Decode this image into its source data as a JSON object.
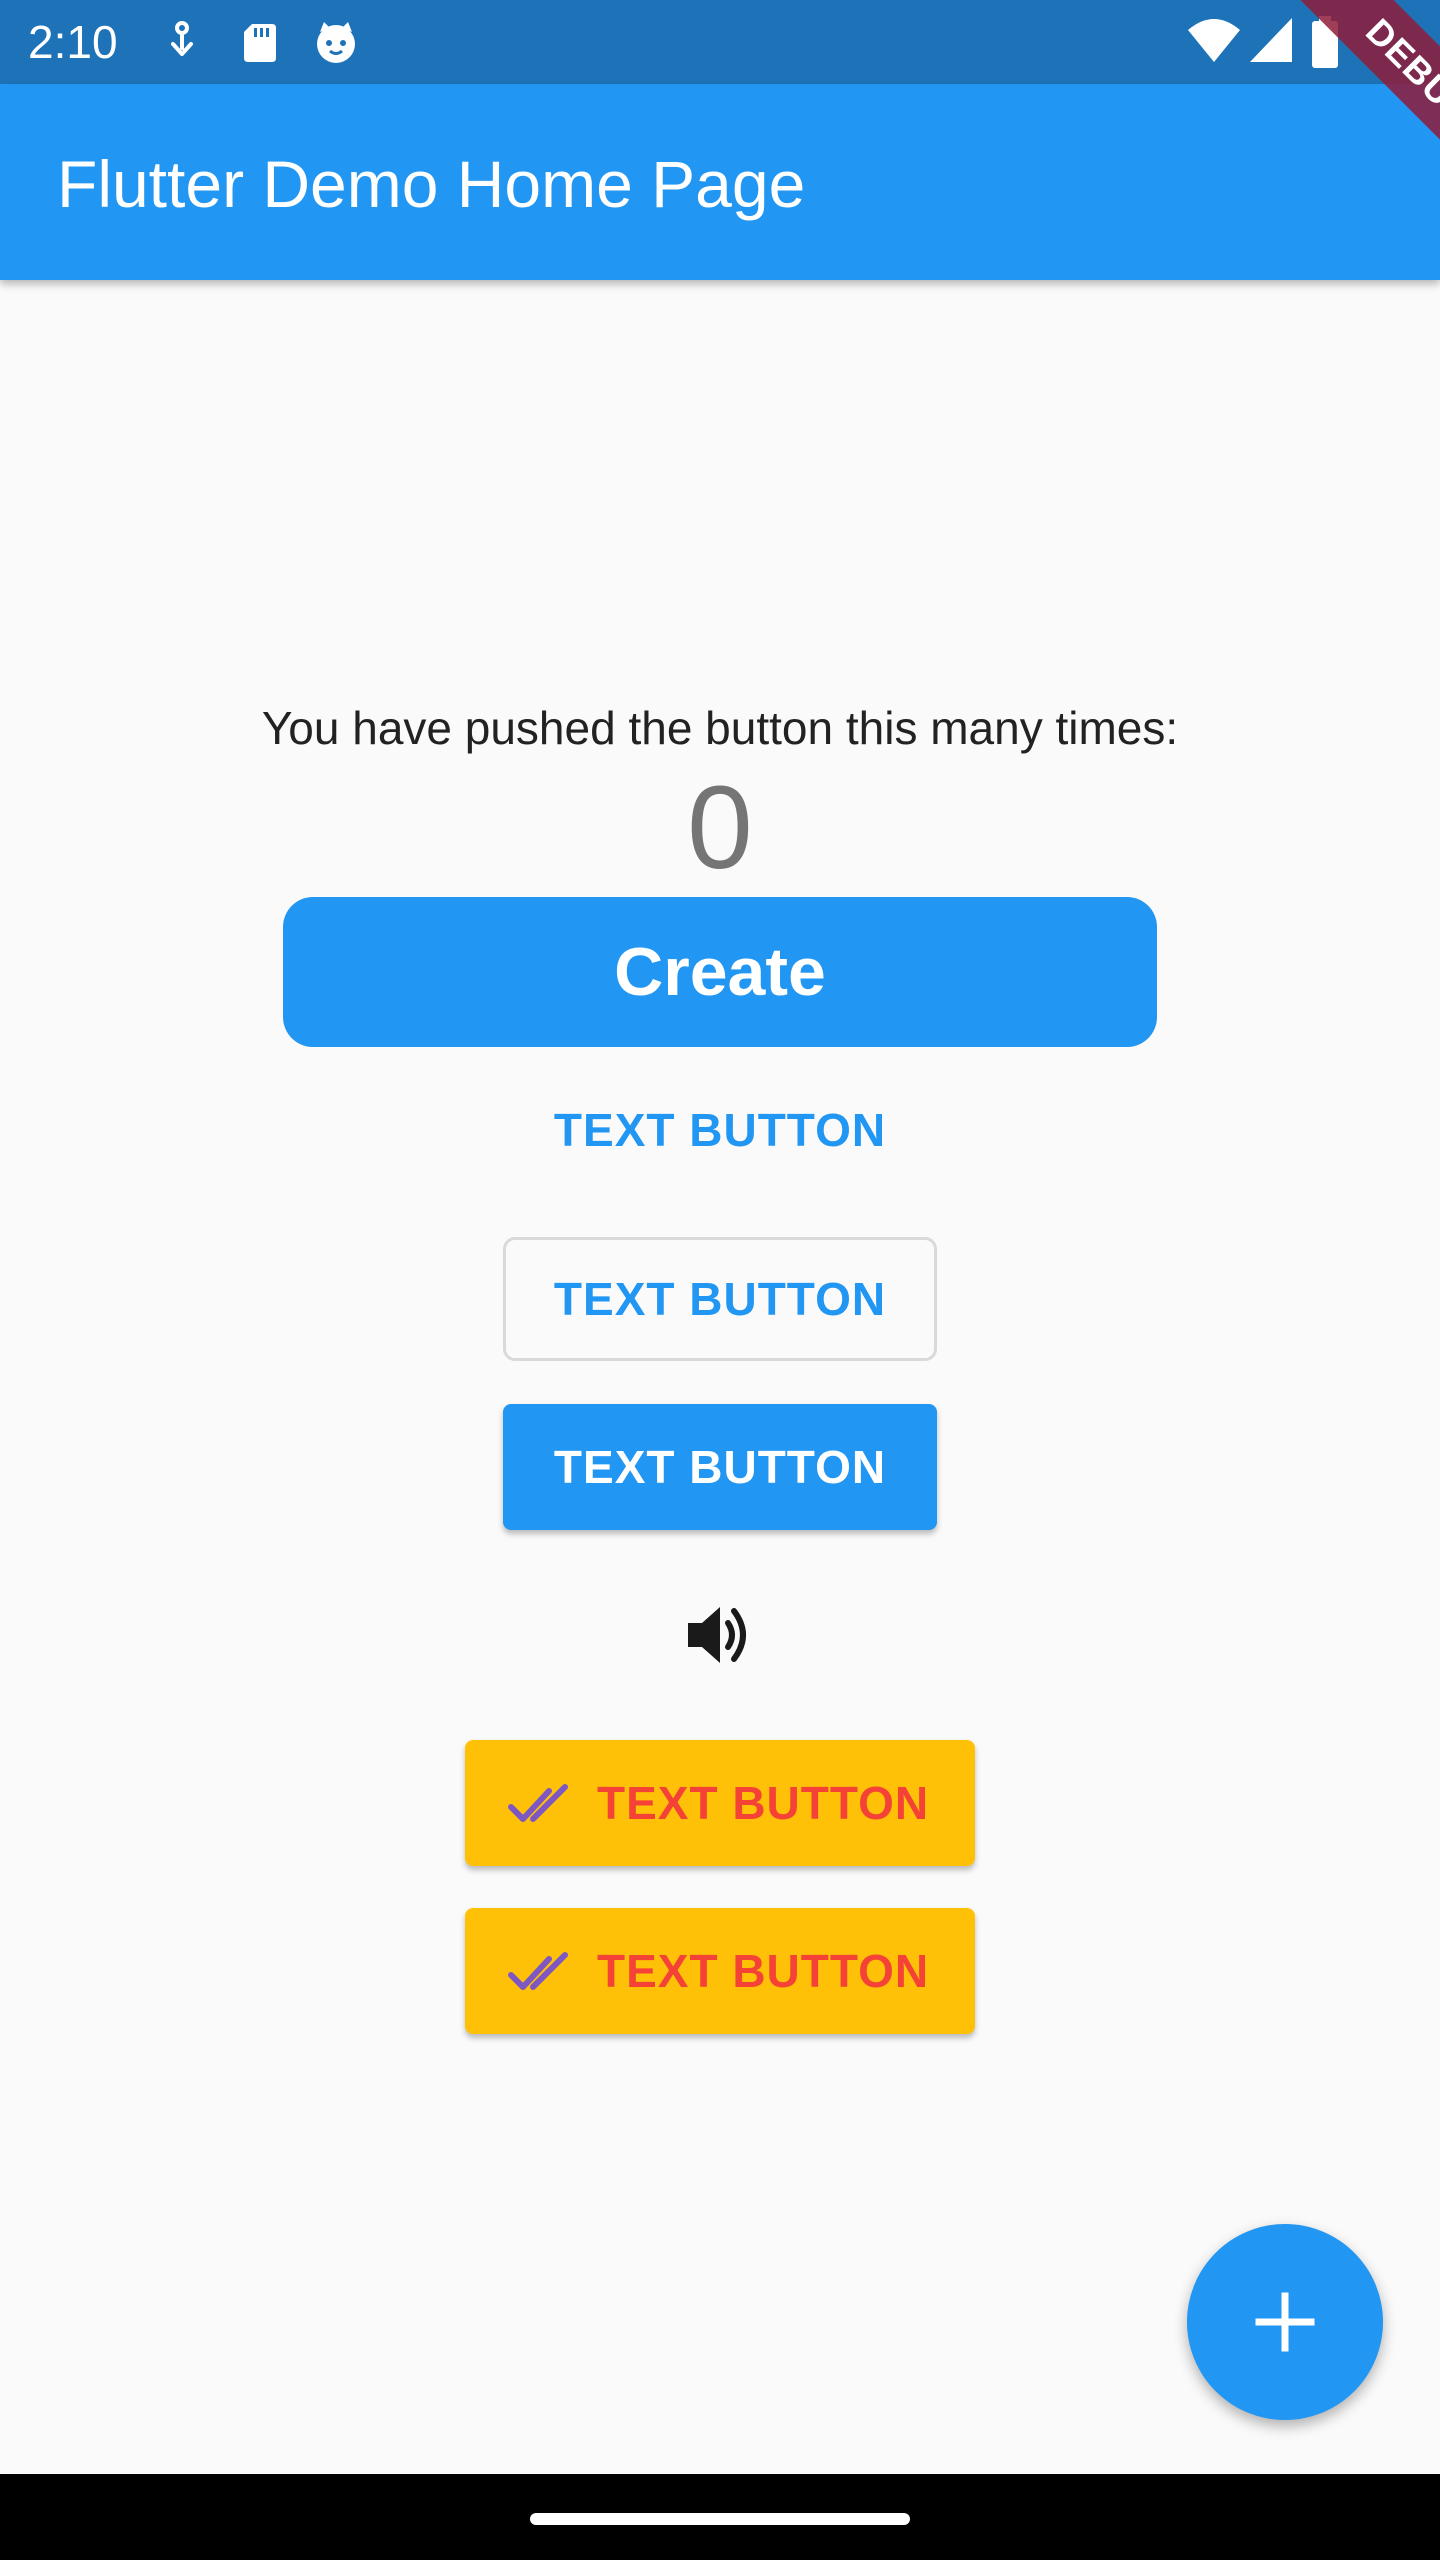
{
  "status_bar": {
    "time": "2:10",
    "left_icons": [
      "download-icon",
      "sd-card-icon",
      "cat-face-icon"
    ],
    "right_icons": [
      "wifi-icon",
      "signal-icon",
      "battery-icon"
    ]
  },
  "debug_banner": {
    "label": "DEBUG"
  },
  "app_bar": {
    "title": "Flutter Demo Home Page",
    "color": "#2196f3"
  },
  "content": {
    "pushed_text": "You have pushed the button this many times:",
    "counter": "0",
    "create_label": "Create",
    "text_button_label": "TEXT BUTTON",
    "outlined_button_label": "TEXT BUTTON",
    "elevated_button_label": "TEXT BUTTON",
    "volume_icon": "volume-up-icon",
    "amber_buttons": [
      {
        "label": "TEXT BUTTON",
        "icon": "double-check-icon"
      },
      {
        "label": "TEXT BUTTON",
        "icon": "double-check-icon"
      }
    ]
  },
  "fab": {
    "icon": "add-icon"
  },
  "colors": {
    "primary": "#2196f3",
    "amber": "#ffc107",
    "red_text": "#f44336",
    "purple_icon": "#7e57c2"
  }
}
